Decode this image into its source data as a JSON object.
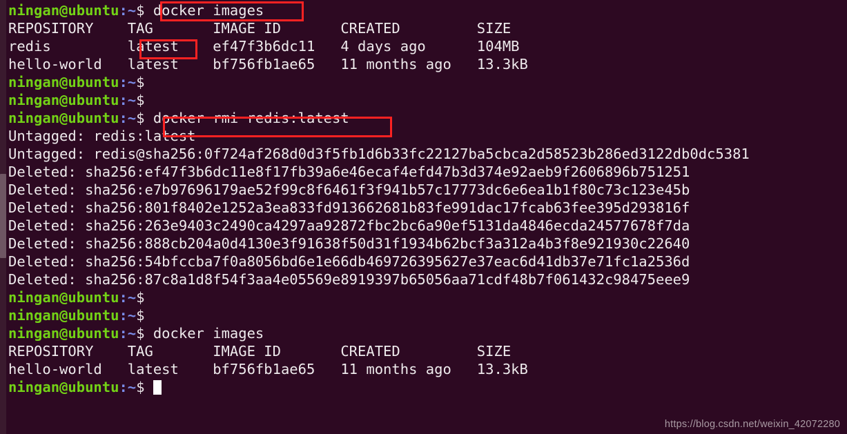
{
  "terminal": {
    "background_color": "#2d0922",
    "prompt_user_color": "#73d216",
    "prompt_path_color": "#7a8ce8",
    "text_color": "#e8e3e6",
    "annotation_color": "#fb2222",
    "prompt": {
      "user_host": "ningan@ubuntu",
      "path": ":~",
      "dollar": "$"
    },
    "lines": [
      {
        "type": "prompt",
        "command": " docker images"
      },
      {
        "type": "output",
        "text": "REPOSITORY    TAG       IMAGE ID       CREATED         SIZE"
      },
      {
        "type": "output",
        "text": "redis         latest    ef47f3b6dc11   4 days ago      104MB"
      },
      {
        "type": "output",
        "text": "hello-world   latest    bf756fb1ae65   11 months ago   13.3kB"
      },
      {
        "type": "prompt",
        "command": ""
      },
      {
        "type": "prompt",
        "command": ""
      },
      {
        "type": "prompt",
        "command": " docker rmi redis:latest"
      },
      {
        "type": "output",
        "text": "Untagged: redis:latest"
      },
      {
        "type": "output",
        "text": "Untagged: redis@sha256:0f724af268d0d3f5fb1d6b33fc22127ba5cbca2d58523b286ed3122db0dc5381"
      },
      {
        "type": "output",
        "text": "Deleted: sha256:ef47f3b6dc11e8f17fb39a6e46ecaf4efd47b3d374e92aeb9f2606896b751251"
      },
      {
        "type": "output",
        "text": "Deleted: sha256:e7b97696179ae52f99c8f6461f3f941b57c17773dc6e6ea1b1f80c73c123e45b"
      },
      {
        "type": "output",
        "text": "Deleted: sha256:801f8402e1252a3ea833fd913662681b83fe991dac17fcab63fee395d293816f"
      },
      {
        "type": "output",
        "text": "Deleted: sha256:263e9403c2490ca4297aa92872fbc2bc6a90ef5131da4846ecda24577678f7da"
      },
      {
        "type": "output",
        "text": "Deleted: sha256:888cb204a0d4130e3f91638f50d31f1934b62bcf3a312a4b3f8e921930c22640"
      },
      {
        "type": "output",
        "text": "Deleted: sha256:54bfccba7f0a8056bd6e1e66db469726395627e37eac6d41db37e71fc1a2536d"
      },
      {
        "type": "output",
        "text": "Deleted: sha256:87c8a1d8f54f3aa4e05569e8919397b65056aa71cdf48b7f061432c98475eee9"
      },
      {
        "type": "prompt",
        "command": ""
      },
      {
        "type": "prompt",
        "command": ""
      },
      {
        "type": "prompt",
        "command": " docker images"
      },
      {
        "type": "output",
        "text": "REPOSITORY    TAG       IMAGE ID       CREATED         SIZE"
      },
      {
        "type": "output",
        "text": "hello-world   latest    bf756fb1ae65   11 months ago   13.3kB"
      },
      {
        "type": "prompt",
        "command": "",
        "cursor": true
      }
    ]
  },
  "annotations": [
    {
      "name": "docker-images-command",
      "label": "docker images"
    },
    {
      "name": "redis-latest-tag",
      "label": "latest"
    },
    {
      "name": "docker-rmi-command",
      "label": "docker rmi redis:latest"
    }
  ],
  "watermark": {
    "text": "https://blog.csdn.net/weixin_42072280"
  }
}
